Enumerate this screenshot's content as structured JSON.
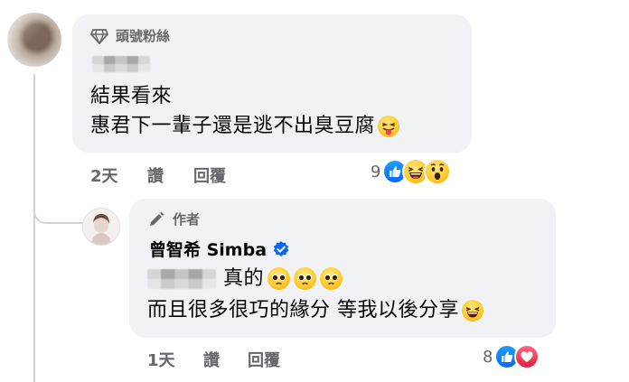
{
  "comment1": {
    "badge_label": "頭號粉絲",
    "text_lines": [
      "結果看來",
      "惠君下一輩子還是逃不出臭豆腐"
    ],
    "time": "2天",
    "like_label": "讚",
    "reply_label": "回覆",
    "reaction_count": "9",
    "reactions": [
      "like-icon",
      "laughing-face-icon",
      "wow-face-icon"
    ]
  },
  "reply1": {
    "badge_label": "作者",
    "author_name": "曾智希 Simba",
    "line1_text": "真的",
    "line2_text": "而且很多很巧的緣分 等我以後分享",
    "time": "1天",
    "like_label": "讚",
    "reply_label": "回覆",
    "reaction_count": "8",
    "reactions": [
      "like-icon",
      "love-icon"
    ]
  },
  "colors": {
    "bubble": "#f0f2f5",
    "secondary_text": "#65676b",
    "like_blue": "#0866ff",
    "love_red": "#e41e3f",
    "verified_blue": "#0866ff"
  }
}
